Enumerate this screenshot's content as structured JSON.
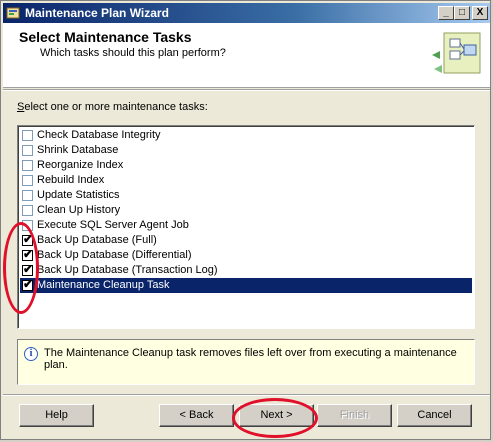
{
  "window": {
    "title": "Maintenance Plan Wizard",
    "controls": [
      "_",
      "□",
      "X"
    ]
  },
  "header": {
    "title": "Select Maintenance Tasks",
    "subtitle": "Which tasks should this plan perform?"
  },
  "list": {
    "label": "Select one or more maintenance tasks:",
    "items": [
      {
        "label": "Check Database Integrity",
        "checked": false,
        "selected": false
      },
      {
        "label": "Shrink Database",
        "checked": false,
        "selected": false
      },
      {
        "label": "Reorganize Index",
        "checked": false,
        "selected": false
      },
      {
        "label": "Rebuild Index",
        "checked": false,
        "selected": false
      },
      {
        "label": "Update Statistics",
        "checked": false,
        "selected": false
      },
      {
        "label": "Clean Up History",
        "checked": false,
        "selected": false
      },
      {
        "label": "Execute SQL Server Agent Job",
        "checked": false,
        "selected": false
      },
      {
        "label": "Back Up Database (Full)",
        "checked": true,
        "selected": false
      },
      {
        "label": "Back Up Database (Differential)",
        "checked": true,
        "selected": false
      },
      {
        "label": "Back Up Database (Transaction Log)",
        "checked": true,
        "selected": false
      },
      {
        "label": "Maintenance Cleanup Task",
        "checked": true,
        "selected": true
      }
    ]
  },
  "info": {
    "text": "The Maintenance Cleanup task removes files left over from executing a maintenance plan."
  },
  "buttons": {
    "help": "Help",
    "back": "< Back",
    "next": "Next >",
    "finish": "Finish",
    "cancel": "Cancel"
  },
  "colors": {
    "selection": "#0a246a",
    "annotation": "#e0102a",
    "info_bg": "#ffffe1"
  }
}
